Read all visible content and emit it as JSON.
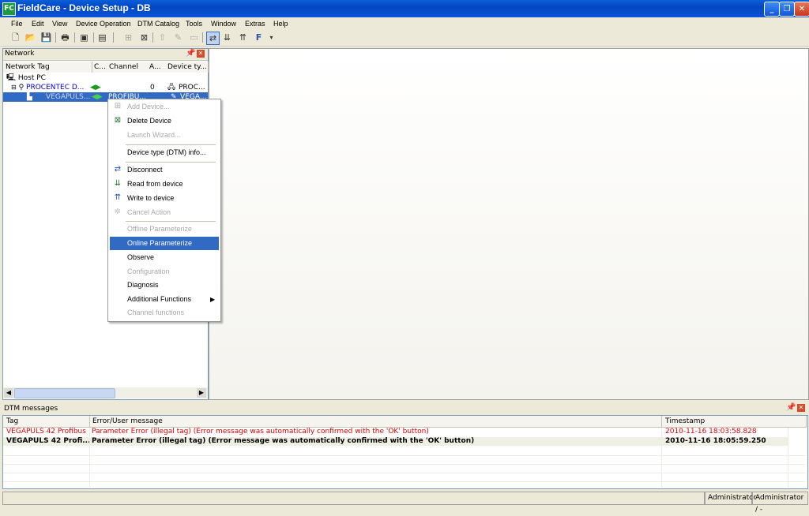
{
  "window": {
    "title": "FieldCare - Device Setup - DB",
    "app_icon_text": "FC"
  },
  "menubar": [
    "File",
    "Edit",
    "View",
    "Device Operation",
    "DTM Catalog",
    "Tools",
    "Window",
    "Extras",
    "Help"
  ],
  "network_panel": {
    "title": "Network",
    "columns": [
      "Network Tag",
      "C...",
      "Channel",
      "A...",
      "Device ty..."
    ],
    "tree": [
      {
        "tag": "Host PC"
      },
      {
        "tag": "PROCENTEC D...",
        "address": "0",
        "device_type": "PROC..."
      },
      {
        "tag": "VEGAPULS...",
        "channel": "PROFIBU...",
        "device_type": "VEGA..."
      }
    ]
  },
  "context_menu": {
    "items": [
      {
        "label": "Add Device...",
        "enabled": false
      },
      {
        "label": "Delete Device",
        "enabled": true
      },
      {
        "label": "Launch Wizard...",
        "enabled": false
      },
      {
        "label": "Device type (DTM) info...",
        "enabled": true
      },
      {
        "label": "Disconnect",
        "enabled": true
      },
      {
        "label": "Read from device",
        "enabled": true
      },
      {
        "label": "Write to device",
        "enabled": true
      },
      {
        "label": "Cancel Action",
        "enabled": false
      },
      {
        "label": "Offline Parameterize",
        "enabled": false
      },
      {
        "label": "Online Parameterize",
        "enabled": true,
        "selected": true
      },
      {
        "label": "Observe",
        "enabled": true
      },
      {
        "label": "Configuration",
        "enabled": false
      },
      {
        "label": "Diagnosis",
        "enabled": true
      },
      {
        "label": "Additional Functions",
        "enabled": true,
        "submenu": true
      },
      {
        "label": "Channel functions",
        "enabled": false
      }
    ]
  },
  "dtm_messages": {
    "title": "DTM messages",
    "columns": [
      "Tag",
      "Error/User message",
      "Timestamp"
    ],
    "rows": [
      {
        "tag": "VEGAPULS 42 Profibus",
        "message": "Parameter Error (illegal tag) (Error message was automatically confirmed with the 'OK' button)",
        "timestamp": "2010-11-16 18:03:58.828",
        "style": "error"
      },
      {
        "tag": "VEGAPULS 42 Profi...",
        "message": "Parameter Error (illegal tag) (Error message was automatically confirmed with the 'OK' button)",
        "timestamp": "2010-11-16 18:05:59.250",
        "style": "bold"
      }
    ]
  },
  "statusbar": {
    "user": "Administrator",
    "role": "Administrator / -"
  },
  "colors": {
    "selection": "#316ac5",
    "error_text": "#e00000",
    "title_blue": "#0a5fd8"
  }
}
